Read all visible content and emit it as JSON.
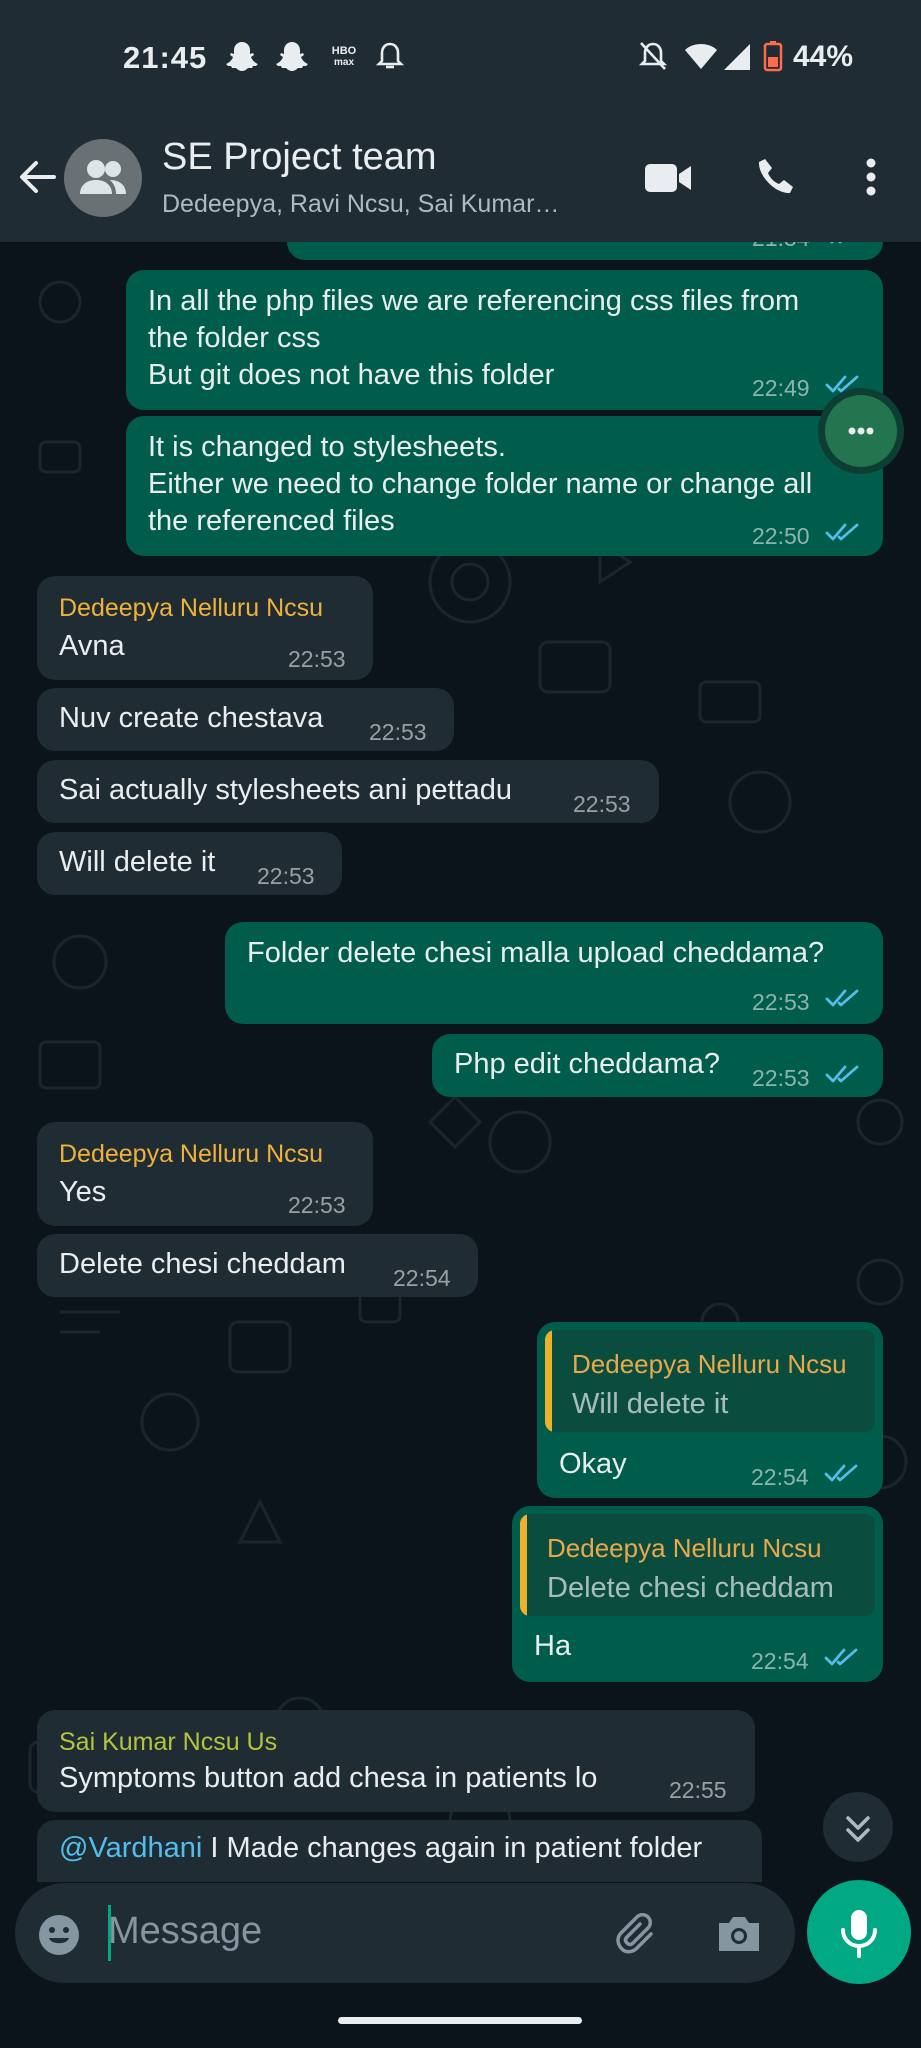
{
  "status_bar": {
    "time": "21:45",
    "app_icons": [
      "snapchat-icon",
      "snapchat-icon",
      "hbo-max-icon",
      "bell-icon"
    ],
    "system_icons": [
      "mute-icon",
      "wifi-icon",
      "signal-icon",
      "battery-icon"
    ],
    "battery_percent": "44%"
  },
  "header": {
    "title": "SE Project team",
    "members": "Dedeepya, Ravi Ncsu, Sai Kumar…",
    "icons": [
      "back-arrow-icon",
      "group-avatar-icon",
      "video-call-icon",
      "voice-call-icon",
      "more-vert-icon"
    ]
  },
  "messages": [
    {
      "dir": "out",
      "partial": true,
      "time": "21:54"
    },
    {
      "dir": "out",
      "text": "In all the php files we are referencing css files from\nthe folder css\nBut git does not have this folder",
      "time": "22:49",
      "status": "read"
    },
    {
      "dir": "out",
      "text": "It is changed to stylesheets.\nEither we need to change folder name or change all\nthe referenced files",
      "time": "22:50",
      "status": "read"
    },
    {
      "dir": "in",
      "sender": "Dedeepya Nelluru Ncsu",
      "text": "Avna",
      "time": "22:53"
    },
    {
      "dir": "in",
      "text": "Nuv create chestava",
      "time": "22:53"
    },
    {
      "dir": "in",
      "text": "Sai actually stylesheets ani pettadu",
      "time": "22:53"
    },
    {
      "dir": "in",
      "text": "Will delete it",
      "time": "22:53"
    },
    {
      "dir": "out",
      "text": "Folder delete chesi malla upload cheddama?",
      "time": "22:53",
      "status": "read"
    },
    {
      "dir": "out",
      "text": "Php edit cheddama?",
      "time": "22:53",
      "status": "read"
    },
    {
      "dir": "in",
      "sender": "Dedeepya Nelluru Ncsu",
      "text": "Yes",
      "time": "22:53"
    },
    {
      "dir": "in",
      "text": "Delete chesi cheddam",
      "time": "22:54"
    },
    {
      "dir": "out",
      "quote": {
        "sender": "Dedeepya Nelluru Ncsu",
        "text": "Will delete it"
      },
      "text": "Okay",
      "time": "22:54",
      "status": "read"
    },
    {
      "dir": "out",
      "quote": {
        "sender": "Dedeepya Nelluru Ncsu",
        "text": "Delete chesi cheddam"
      },
      "text": "Ha",
      "time": "22:54",
      "status": "read"
    },
    {
      "dir": "in",
      "sender": "Sai Kumar Ncsu Us",
      "text": "Symptoms button add chesa in patients lo",
      "time": "22:55"
    },
    {
      "dir": "in",
      "mention": "@Vardhani",
      "text": " I Made changes again in patient folder",
      "partial": true
    }
  ],
  "colors": {
    "header_bg": "#1f2c34",
    "chat_bg": "#0b141a",
    "outgoing_bubble": "#005c4b",
    "incoming_bubble": "#1f2c34",
    "accent": "#00a884",
    "read_ticks": "#53bdeb",
    "sender_dedeepya": "#f0b13a",
    "sender_sai": "#b7c33a",
    "mention": "#53bdeb"
  },
  "composer": {
    "placeholder": "Message",
    "icons": [
      "emoji-icon",
      "attach-icon",
      "camera-icon",
      "mic-icon"
    ]
  },
  "floating": {
    "icons": [
      "more-options-icon",
      "scroll-down-icon"
    ]
  }
}
